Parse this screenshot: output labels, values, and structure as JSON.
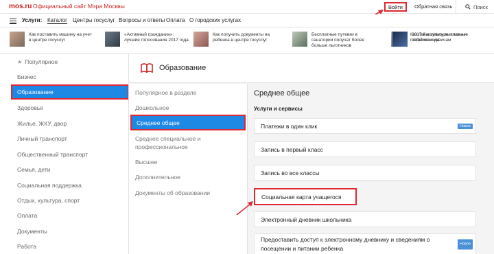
{
  "header": {
    "logo": "mos.ru",
    "site_title": "Официальный сайт Мэра Москвы",
    "login_label": "Войти",
    "feedback_label": "Обратная связь",
    "search_label": "Поиск"
  },
  "nav": {
    "label": "Услуги:",
    "items": [
      "Каталог",
      "Центры госуслуг",
      "Вопросы и ответы",
      "Оплата",
      "О городских услугах"
    ]
  },
  "news": [
    {
      "text": "Как поставить машину на учет в центре госуслуг"
    },
    {
      "text": "«Активный гражданин»: лучшие голосования 2017 года"
    },
    {
      "text": "Как получить документы на ребенка в центре госуслуг"
    },
    {
      "text": "Бесплатные путевки в санатории получат более больше льготников"
    },
    {
      "text": "Как повысились выплаты и пособия москвичам"
    },
    {
      "text": "2017-й в культуре: главные события года"
    }
  ],
  "categories": {
    "popular": "Популярное",
    "items": [
      "Бизнес",
      "Образование",
      "Здоровье",
      "Жилье, ЖКУ, двор",
      "Личный транспорт",
      "Общественный транспорт",
      "Семья, дети",
      "Социальная поддержка",
      "Отдых, культура, спорт",
      "Оплата",
      "Документы",
      "Работа"
    ]
  },
  "section": {
    "title": "Образование",
    "subcategories": [
      "Популярное в разделе",
      "Дошкольное",
      "Среднее общее",
      "Среднее специальное и профессиональное",
      "Высшее",
      "Дополнительное",
      "Документы об образовании"
    ]
  },
  "content": {
    "title": "Среднее общее",
    "subtitle": "Услуги и сервисы",
    "services": [
      {
        "label": "Платежи в один клик",
        "badge": "Новое"
      },
      {
        "label": "Запись в первый класс",
        "badge": ""
      },
      {
        "label": "Запись во все классы",
        "badge": ""
      },
      {
        "label": "Социальная карта учащегося",
        "badge": ""
      },
      {
        "label": "Электронный дневник школьника",
        "badge": ""
      },
      {
        "label": "Предоставить доступ к электронному дневнику и сведениям о посещении и питании ребенка",
        "badge": "Новое"
      }
    ]
  },
  "colors": {
    "brand_red": "#cc1f1f",
    "highlight_red": "#e0262f",
    "active_blue": "#1e88e5"
  }
}
